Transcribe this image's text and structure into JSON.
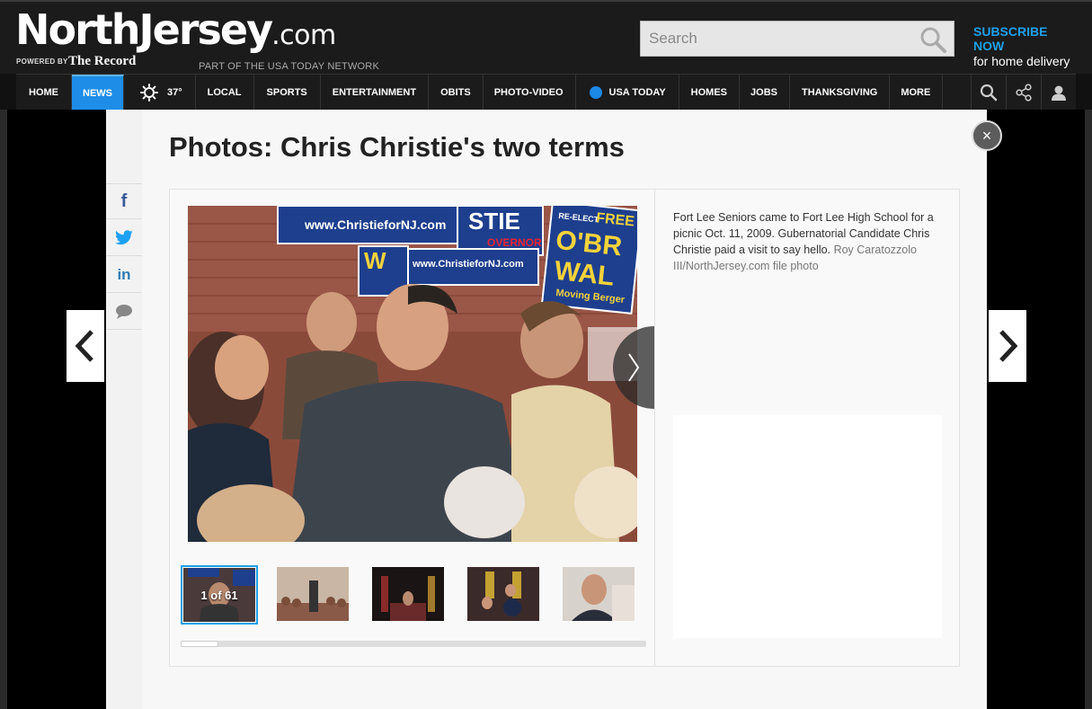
{
  "header": {
    "logo_main": "NorthJersey",
    "logo_dotcom": ".com",
    "powered_by": "POWERED BY",
    "record": "The Record",
    "network": "PART OF THE USA TODAY NETWORK",
    "search_placeholder": "Search",
    "subscribe_line1": "SUBSCRIBE NOW",
    "subscribe_line2": "for home delivery"
  },
  "nav": {
    "items": [
      "HOME",
      "NEWS",
      "37°",
      "LOCAL",
      "SPORTS",
      "ENTERTAINMENT",
      "OBITS",
      "PHOTO-VIDEO",
      "USA TODAY",
      "HOMES",
      "JOBS",
      "THANKSGIVING",
      "MORE"
    ],
    "active": "NEWS",
    "right_icons": [
      "search-icon",
      "share-icon",
      "user-icon"
    ]
  },
  "share": {
    "facebook": "f",
    "twitter": "twitter-icon",
    "linkedin": "in",
    "comment": "comment-icon"
  },
  "gallery": {
    "title": "Photos: Chris Christie's two terms",
    "caption": "Fort Lee Seniors came to Fort Lee High School for a picnic Oct. 11, 2009. Gubernatorial Candidate Chris Christie paid a visit to say hello.",
    "credit": "Roy Caratozzolo III/NorthJersey.com file photo",
    "counter": "1 of 61",
    "sign_texts": {
      "website": "www.ChristieforNJ.com",
      "governor": "OVERNOR",
      "reelect": "RE-ELECT",
      "obr": "O'BR",
      "wal": "WAL",
      "moving": "Moving Berger",
      "freeh": "FREE",
      "stie": "STIE",
      "w": "W"
    },
    "close_label": "×"
  },
  "colors": {
    "accent": "#1ea0e6",
    "nav_active": "#1d8de8",
    "header_bg": "#1b1b1b",
    "modal_bg": "#f7f7f7"
  }
}
